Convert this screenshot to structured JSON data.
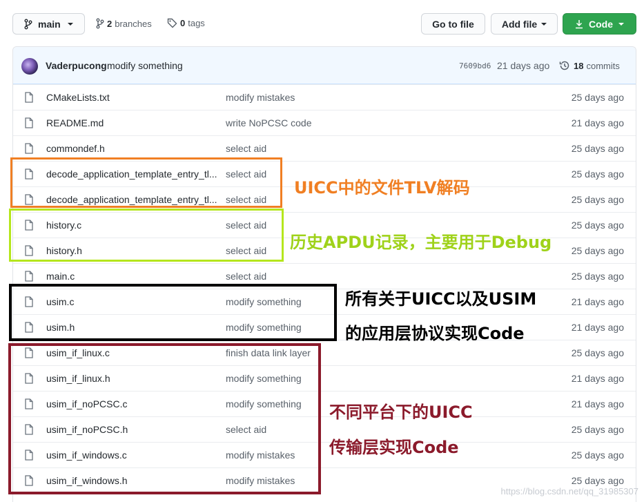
{
  "toolbar": {
    "branch": "main",
    "branches_count": "2",
    "branches_label": "branches",
    "tags_count": "0",
    "tags_label": "tags",
    "goto_file": "Go to file",
    "add_file": "Add file",
    "code": "Code"
  },
  "latest_commit": {
    "author": "Vaderpucong",
    "message": "modify something",
    "sha": "7609bd6",
    "age": "21 days ago",
    "commits_count": "18",
    "commits_label": "commits"
  },
  "files": [
    {
      "name": "CMakeLists.txt",
      "message": "modify mistakes",
      "age": "25 days ago"
    },
    {
      "name": "README.md",
      "message": "write NoPCSC code",
      "age": "21 days ago"
    },
    {
      "name": "commondef.h",
      "message": "select aid",
      "age": "25 days ago"
    },
    {
      "name": "decode_application_template_entry_tl...",
      "message": "select aid",
      "age": "25 days ago"
    },
    {
      "name": "decode_application_template_entry_tl...",
      "message": "select aid",
      "age": "25 days ago"
    },
    {
      "name": "history.c",
      "message": "select aid",
      "age": "25 days ago"
    },
    {
      "name": "history.h",
      "message": "select aid",
      "age": "25 days ago"
    },
    {
      "name": "main.c",
      "message": "select aid",
      "age": "25 days ago"
    },
    {
      "name": "usim.c",
      "message": "modify something",
      "age": "21 days ago"
    },
    {
      "name": "usim.h",
      "message": "modify something",
      "age": "21 days ago"
    },
    {
      "name": "usim_if_linux.c",
      "message": "finish data link layer",
      "age": "25 days ago"
    },
    {
      "name": "usim_if_linux.h",
      "message": "modify something",
      "age": "21 days ago"
    },
    {
      "name": "usim_if_noPCSC.c",
      "message": "modify something",
      "age": "21 days ago"
    },
    {
      "name": "usim_if_noPCSC.h",
      "message": "select aid",
      "age": "25 days ago"
    },
    {
      "name": "usim_if_windows.c",
      "message": "modify mistakes",
      "age": "25 days ago"
    },
    {
      "name": "usim_if_windows.h",
      "message": "modify mistakes",
      "age": "25 days ago"
    }
  ],
  "annotations": {
    "orange_text": "UICC中的文件TLV解码",
    "green_text": "历史APDU记录，主要用于Debug",
    "black_line1": "所有关于UICC以及USIM",
    "black_line2": "的应用层协议实现Code",
    "red_line1": "不同平台下的UICC",
    "red_line2": "传输层实现Code"
  },
  "colors": {
    "orange": "#f07f23",
    "green": "#b5e61d",
    "green_text": "#9fd21a",
    "black": "#000000",
    "maroon": "#8b1a2b",
    "code_button": "#2ea44f"
  },
  "watermark": "https://blog.csdn.net/qq_31985307"
}
